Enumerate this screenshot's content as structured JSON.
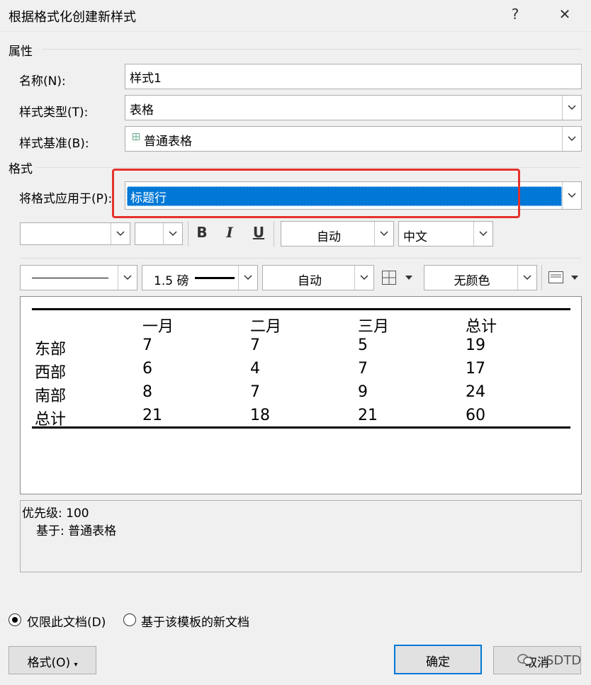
{
  "window": {
    "title": "根据格式化创建新样式",
    "help": "?",
    "close": "✕"
  },
  "properties": {
    "section": "属性",
    "name_label": "名称(N):",
    "name_value": "样式1",
    "type_label": "样式类型(T):",
    "type_value": "表格",
    "base_label": "样式基准(B):",
    "base_value": "普通表格"
  },
  "format": {
    "section": "格式",
    "apply_label": "将格式应用于(P):",
    "apply_value": "标题行",
    "bold": "B",
    "italic": "I",
    "underline": "U",
    "font_color": "自动",
    "lang": "中文",
    "line_weight": "1.5 磅",
    "border_color": "自动",
    "shading": "无颜色"
  },
  "preview": {
    "headers": [
      "",
      "一月",
      "二月",
      "三月",
      "总计"
    ],
    "rows": [
      [
        "东部",
        "7",
        "7",
        "5",
        "19"
      ],
      [
        "西部",
        "6",
        "4",
        "7",
        "17"
      ],
      [
        "南部",
        "8",
        "7",
        "9",
        "24"
      ],
      [
        "总计",
        "21",
        "18",
        "21",
        "60"
      ]
    ]
  },
  "description": {
    "priority": "优先级: 100",
    "based_on": "基于: 普通表格"
  },
  "options": {
    "this_doc": "仅限此文档(D)",
    "template": "基于该模板的新文档"
  },
  "buttons": {
    "format": "格式(O)",
    "ok": "确定",
    "cancel": "取消"
  },
  "watermark": "SDTD"
}
